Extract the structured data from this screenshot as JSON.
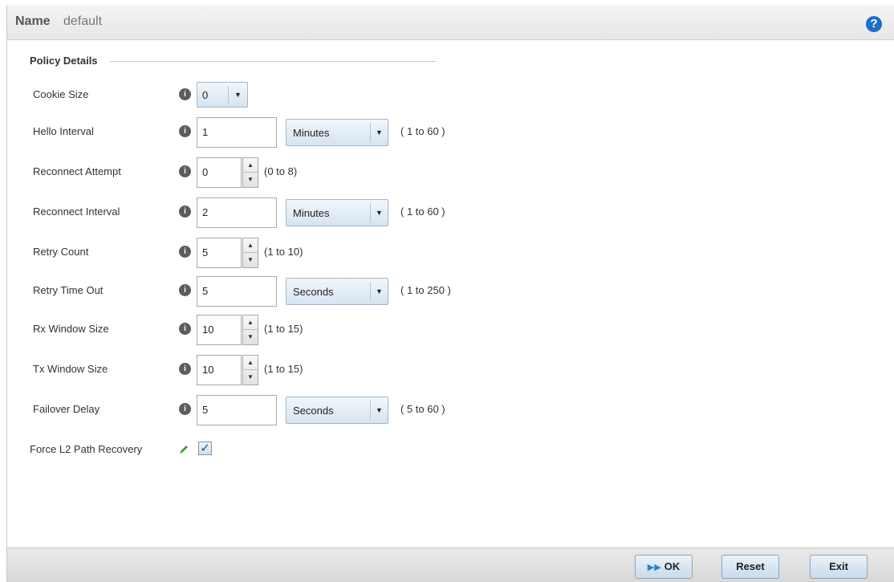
{
  "header": {
    "name_label": "Name",
    "name_value": "default",
    "help_icon": "?"
  },
  "section": {
    "title": "Policy Details"
  },
  "fields": {
    "cookie_size": {
      "label": "Cookie Size",
      "value": "0"
    },
    "hello_interval": {
      "label": "Hello Interval",
      "value": "1",
      "unit": "Minutes",
      "range": "( 1 to 60 )"
    },
    "reconnect_attempt": {
      "label": "Reconnect Attempt",
      "value": "0",
      "range": "(0 to 8)"
    },
    "reconnect_interval": {
      "label": "Reconnect Interval",
      "value": "2",
      "unit": "Minutes",
      "range": "( 1 to 60 )"
    },
    "retry_count": {
      "label": "Retry Count",
      "value": "5",
      "range": "(1 to 10)"
    },
    "retry_time_out": {
      "label": "Retry Time Out",
      "value": "5",
      "unit": "Seconds",
      "range": "( 1 to 250 )"
    },
    "rx_window_size": {
      "label": "Rx Window Size",
      "value": "10",
      "range": "(1 to 15)"
    },
    "tx_window_size": {
      "label": "Tx Window Size",
      "value": "10",
      "range": "(1 to 15)"
    },
    "failover_delay": {
      "label": "Failover Delay",
      "value": "5",
      "unit": "Seconds",
      "range": "( 5 to 60 )"
    },
    "force_l2_path_recovery": {
      "label": "Force L2 Path Recovery",
      "checked": true
    }
  },
  "footer": {
    "ok_label": "OK",
    "reset_label": "Reset",
    "exit_label": "Exit"
  }
}
